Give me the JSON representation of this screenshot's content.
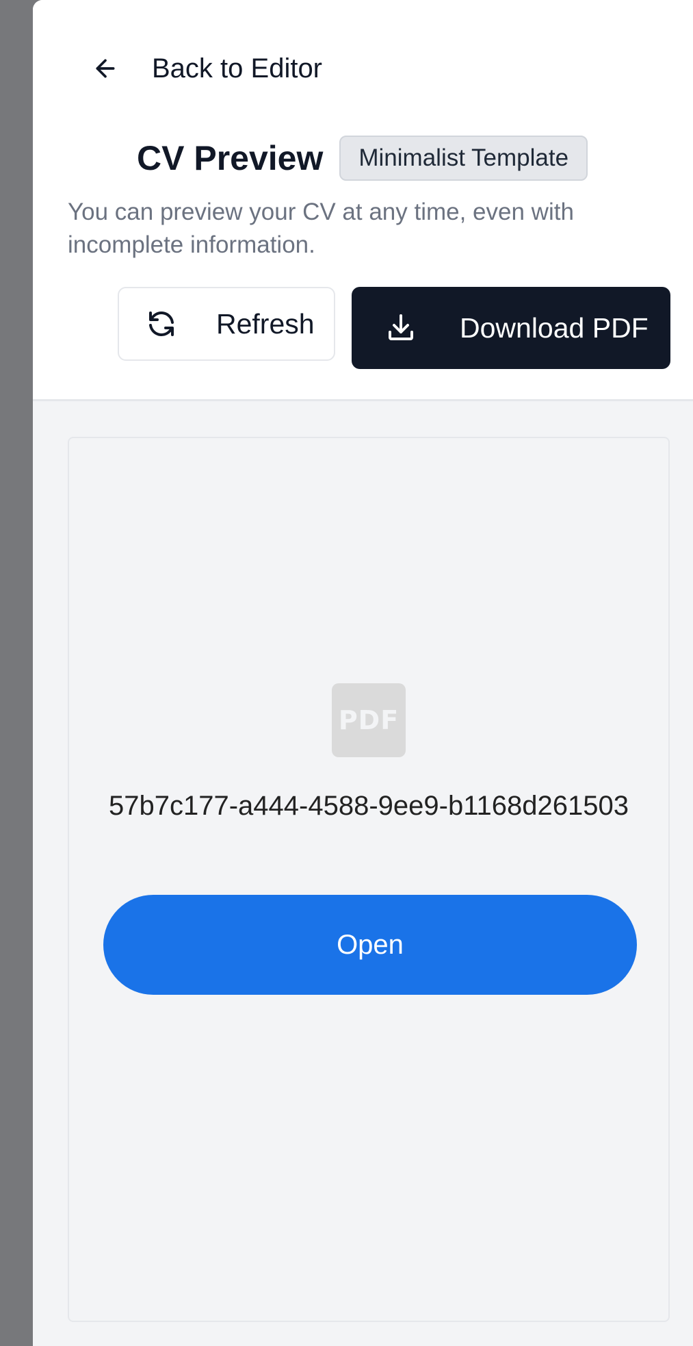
{
  "header": {
    "back_label": "Back to Editor",
    "title": "CV Preview",
    "template_badge": "Minimalist Template",
    "subtitle": "You can preview your CV at any time, even with incomplete information."
  },
  "actions": {
    "refresh_label": "Refresh",
    "download_label": "Download PDF"
  },
  "viewer": {
    "file_icon_text": "PDF",
    "file_name": "57b7c177-a444-4588-9ee9-b1168d261503",
    "open_label": "Open"
  },
  "colors": {
    "primary_dark": "#111827",
    "open_button_blue": "#1a73e8",
    "backdrop_gray": "#77787b"
  },
  "icons": {
    "back": "arrow-left-icon",
    "refresh": "refresh-icon",
    "download": "download-icon",
    "file": "pdf-file-icon"
  }
}
